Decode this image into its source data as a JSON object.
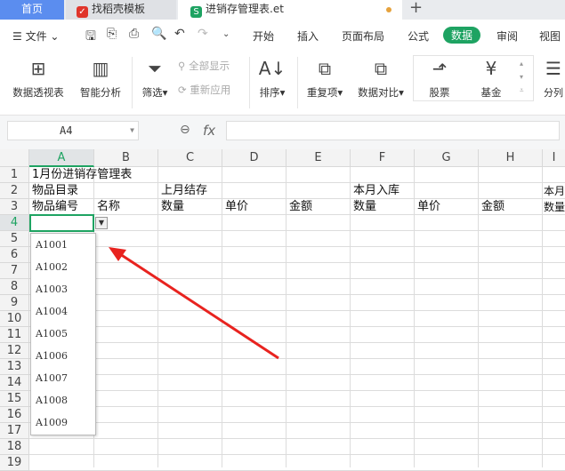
{
  "tabs": {
    "home": "首页",
    "template": "找稻壳模板",
    "document": "进销存管理表.et",
    "new": "+"
  },
  "menu": {
    "file": "文件",
    "items": [
      "开始",
      "插入",
      "页面布局",
      "公式",
      "数据",
      "审阅",
      "视图"
    ],
    "active": "数据"
  },
  "ribbon": {
    "pivot": "数据透视表",
    "smart": "智能分析",
    "filter": "筛选",
    "show_all": "全部显示",
    "reapply": "重新应用",
    "sort": "排序",
    "duplicates": "重复项",
    "compare": "数据对比",
    "stock": "股票",
    "fund": "基金",
    "split": "分列"
  },
  "formula_bar": {
    "name_box": "A4",
    "fx": "fx",
    "value": ""
  },
  "columns": [
    "A",
    "B",
    "C",
    "D",
    "E",
    "F",
    "G",
    "H",
    "I"
  ],
  "rows": [
    "1",
    "2",
    "3",
    "4",
    "5",
    "6",
    "7",
    "8",
    "9",
    "10",
    "11",
    "12",
    "13",
    "14",
    "15",
    "16",
    "17",
    "18",
    "19"
  ],
  "cells": {
    "r1a": "1月份进销存管理表",
    "r2a": "物品目录",
    "r2c": "上月结存",
    "r2f": "本月入库",
    "r2i": "本月",
    "r3": [
      "物品编号",
      "名称",
      "数量",
      "单价",
      "金额",
      "数量",
      "单价",
      "金额",
      "数量"
    ]
  },
  "dropdown": [
    "A1001",
    "A1002",
    "A1003",
    "A1004",
    "A1005",
    "A1006",
    "A1007",
    "A1008",
    "A1009"
  ],
  "colors": {
    "accent": "#1ea362",
    "arrow": "#e8231f"
  }
}
